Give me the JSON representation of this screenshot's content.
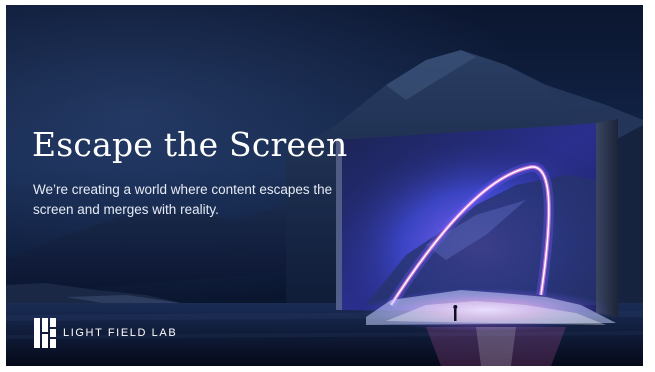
{
  "hero": {
    "headline": "Escape the Screen",
    "subtext": "We’re creating a world where content escapes the screen and merges with reality."
  },
  "brand": {
    "logo_text": "LIGHT FIELD LAB",
    "logo_icon": "light-field-lab-logo-icon"
  },
  "colors": {
    "sky_dark": "#0b1630",
    "sky_mid": "#13264a",
    "glow_pink": "#ff6fd8",
    "glow_blue": "#4d5bff",
    "text": "#ffffff"
  }
}
